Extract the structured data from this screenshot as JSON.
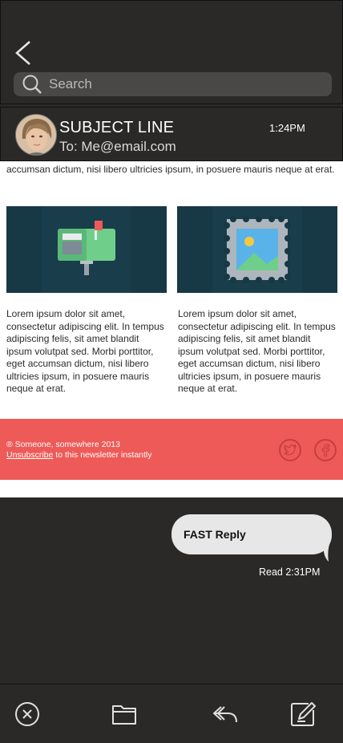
{
  "search": {
    "placeholder": "Search"
  },
  "header": {
    "subject": "SUBJECT LINE",
    "to": "To: Me@email.com",
    "time": "1:24PM"
  },
  "email": {
    "partial_text": "accumsan dictum, nisi libero ultricies ipsum, in posuere mauris neque at erat.",
    "cards": [
      {
        "icon": "mailbox-icon",
        "text": "Lorem ipsum dolor sit amet, consectetur adipiscing elit. In tempus adipiscing felis, sit amet blandit ipsum volutpat sed. Morbi porttitor, eget accumsan dictum, nisi libero ultricies ipsum, in posuere mauris neque at erat."
      },
      {
        "icon": "picture-stamp-icon",
        "text": "Lorem ipsum dolor sit amet, consectetur adipiscing elit. In tempus adipiscing felis, sit amet blandit ipsum volutpat sed. Morbi porttitor, eget accumsan dictum, nisi libero ultricies ipsum, in posuere mauris neque at erat."
      }
    ],
    "footer": {
      "copyright": "® Someone, somewhere 2013",
      "unsubscribe": "Unsubscribe",
      "unsubscribe_suffix": " to this newsletter instantly",
      "twitter_icon": "twitter-icon",
      "facebook_icon": "facebook-icon"
    }
  },
  "reply": {
    "text": "FAST Reply",
    "status": "Read 2:31PM"
  },
  "toolbar": {
    "icons": [
      "close-circle-icon",
      "folder-icon",
      "reply-icon",
      "compose-icon"
    ]
  },
  "colors": {
    "background": "#2b2928",
    "footer": "#ee5a57",
    "card": "#173845"
  }
}
